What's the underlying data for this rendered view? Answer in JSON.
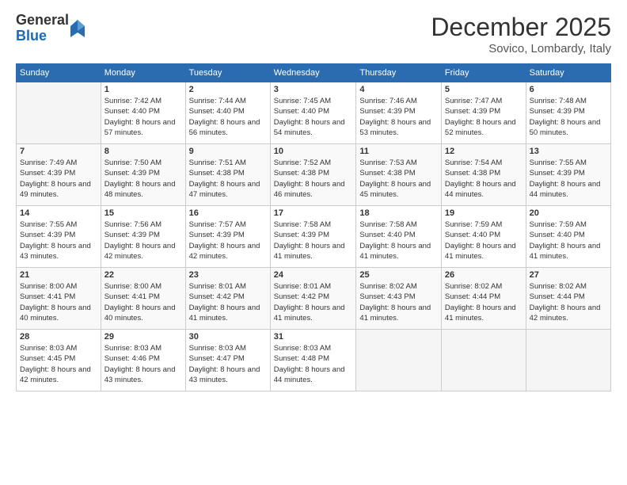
{
  "logo": {
    "general": "General",
    "blue": "Blue"
  },
  "title": "December 2025",
  "location": "Sovico, Lombardy, Italy",
  "days_of_week": [
    "Sunday",
    "Monday",
    "Tuesday",
    "Wednesday",
    "Thursday",
    "Friday",
    "Saturday"
  ],
  "weeks": [
    [
      {
        "day": "",
        "empty": true
      },
      {
        "day": "1",
        "sunrise": "Sunrise: 7:42 AM",
        "sunset": "Sunset: 4:40 PM",
        "daylight": "Daylight: 8 hours and 57 minutes."
      },
      {
        "day": "2",
        "sunrise": "Sunrise: 7:44 AM",
        "sunset": "Sunset: 4:40 PM",
        "daylight": "Daylight: 8 hours and 56 minutes."
      },
      {
        "day": "3",
        "sunrise": "Sunrise: 7:45 AM",
        "sunset": "Sunset: 4:40 PM",
        "daylight": "Daylight: 8 hours and 54 minutes."
      },
      {
        "day": "4",
        "sunrise": "Sunrise: 7:46 AM",
        "sunset": "Sunset: 4:39 PM",
        "daylight": "Daylight: 8 hours and 53 minutes."
      },
      {
        "day": "5",
        "sunrise": "Sunrise: 7:47 AM",
        "sunset": "Sunset: 4:39 PM",
        "daylight": "Daylight: 8 hours and 52 minutes."
      },
      {
        "day": "6",
        "sunrise": "Sunrise: 7:48 AM",
        "sunset": "Sunset: 4:39 PM",
        "daylight": "Daylight: 8 hours and 50 minutes."
      }
    ],
    [
      {
        "day": "7",
        "sunrise": "Sunrise: 7:49 AM",
        "sunset": "Sunset: 4:39 PM",
        "daylight": "Daylight: 8 hours and 49 minutes."
      },
      {
        "day": "8",
        "sunrise": "Sunrise: 7:50 AM",
        "sunset": "Sunset: 4:39 PM",
        "daylight": "Daylight: 8 hours and 48 minutes."
      },
      {
        "day": "9",
        "sunrise": "Sunrise: 7:51 AM",
        "sunset": "Sunset: 4:38 PM",
        "daylight": "Daylight: 8 hours and 47 minutes."
      },
      {
        "day": "10",
        "sunrise": "Sunrise: 7:52 AM",
        "sunset": "Sunset: 4:38 PM",
        "daylight": "Daylight: 8 hours and 46 minutes."
      },
      {
        "day": "11",
        "sunrise": "Sunrise: 7:53 AM",
        "sunset": "Sunset: 4:38 PM",
        "daylight": "Daylight: 8 hours and 45 minutes."
      },
      {
        "day": "12",
        "sunrise": "Sunrise: 7:54 AM",
        "sunset": "Sunset: 4:38 PM",
        "daylight": "Daylight: 8 hours and 44 minutes."
      },
      {
        "day": "13",
        "sunrise": "Sunrise: 7:55 AM",
        "sunset": "Sunset: 4:39 PM",
        "daylight": "Daylight: 8 hours and 44 minutes."
      }
    ],
    [
      {
        "day": "14",
        "sunrise": "Sunrise: 7:55 AM",
        "sunset": "Sunset: 4:39 PM",
        "daylight": "Daylight: 8 hours and 43 minutes."
      },
      {
        "day": "15",
        "sunrise": "Sunrise: 7:56 AM",
        "sunset": "Sunset: 4:39 PM",
        "daylight": "Daylight: 8 hours and 42 minutes."
      },
      {
        "day": "16",
        "sunrise": "Sunrise: 7:57 AM",
        "sunset": "Sunset: 4:39 PM",
        "daylight": "Daylight: 8 hours and 42 minutes."
      },
      {
        "day": "17",
        "sunrise": "Sunrise: 7:58 AM",
        "sunset": "Sunset: 4:39 PM",
        "daylight": "Daylight: 8 hours and 41 minutes."
      },
      {
        "day": "18",
        "sunrise": "Sunrise: 7:58 AM",
        "sunset": "Sunset: 4:40 PM",
        "daylight": "Daylight: 8 hours and 41 minutes."
      },
      {
        "day": "19",
        "sunrise": "Sunrise: 7:59 AM",
        "sunset": "Sunset: 4:40 PM",
        "daylight": "Daylight: 8 hours and 41 minutes."
      },
      {
        "day": "20",
        "sunrise": "Sunrise: 7:59 AM",
        "sunset": "Sunset: 4:40 PM",
        "daylight": "Daylight: 8 hours and 41 minutes."
      }
    ],
    [
      {
        "day": "21",
        "sunrise": "Sunrise: 8:00 AM",
        "sunset": "Sunset: 4:41 PM",
        "daylight": "Daylight: 8 hours and 40 minutes."
      },
      {
        "day": "22",
        "sunrise": "Sunrise: 8:00 AM",
        "sunset": "Sunset: 4:41 PM",
        "daylight": "Daylight: 8 hours and 40 minutes."
      },
      {
        "day": "23",
        "sunrise": "Sunrise: 8:01 AM",
        "sunset": "Sunset: 4:42 PM",
        "daylight": "Daylight: 8 hours and 41 minutes."
      },
      {
        "day": "24",
        "sunrise": "Sunrise: 8:01 AM",
        "sunset": "Sunset: 4:42 PM",
        "daylight": "Daylight: 8 hours and 41 minutes."
      },
      {
        "day": "25",
        "sunrise": "Sunrise: 8:02 AM",
        "sunset": "Sunset: 4:43 PM",
        "daylight": "Daylight: 8 hours and 41 minutes."
      },
      {
        "day": "26",
        "sunrise": "Sunrise: 8:02 AM",
        "sunset": "Sunset: 4:44 PM",
        "daylight": "Daylight: 8 hours and 41 minutes."
      },
      {
        "day": "27",
        "sunrise": "Sunrise: 8:02 AM",
        "sunset": "Sunset: 4:44 PM",
        "daylight": "Daylight: 8 hours and 42 minutes."
      }
    ],
    [
      {
        "day": "28",
        "sunrise": "Sunrise: 8:03 AM",
        "sunset": "Sunset: 4:45 PM",
        "daylight": "Daylight: 8 hours and 42 minutes."
      },
      {
        "day": "29",
        "sunrise": "Sunrise: 8:03 AM",
        "sunset": "Sunset: 4:46 PM",
        "daylight": "Daylight: 8 hours and 43 minutes."
      },
      {
        "day": "30",
        "sunrise": "Sunrise: 8:03 AM",
        "sunset": "Sunset: 4:47 PM",
        "daylight": "Daylight: 8 hours and 43 minutes."
      },
      {
        "day": "31",
        "sunrise": "Sunrise: 8:03 AM",
        "sunset": "Sunset: 4:48 PM",
        "daylight": "Daylight: 8 hours and 44 minutes."
      },
      {
        "day": "",
        "empty": true
      },
      {
        "day": "",
        "empty": true
      },
      {
        "day": "",
        "empty": true
      }
    ]
  ]
}
